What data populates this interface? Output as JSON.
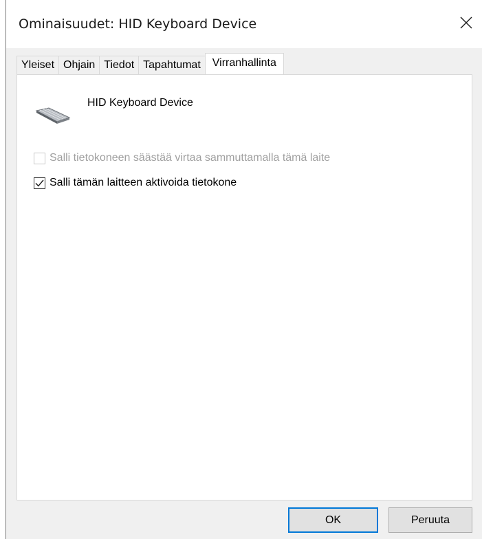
{
  "window": {
    "title": "Ominaisuudet: HID Keyboard Device"
  },
  "tabs": [
    {
      "label": "Yleiset"
    },
    {
      "label": "Ohjain"
    },
    {
      "label": "Tiedot"
    },
    {
      "label": "Tapahtumat"
    },
    {
      "label": "Virranhallinta",
      "active": true
    }
  ],
  "device": {
    "name": "HID Keyboard Device",
    "icon": "keyboard-icon"
  },
  "options": [
    {
      "label": "Salli tietokoneen säästää virtaa sammuttamalla tämä laite",
      "checked": false,
      "enabled": false
    },
    {
      "label": "Salli tämän laitteen aktivoida tietokone",
      "checked": true,
      "enabled": true
    }
  ],
  "buttons": {
    "ok": "OK",
    "cancel": "Peruuta"
  },
  "colors": {
    "accent": "#0078d7",
    "disabled_text": "#a0a0a0"
  }
}
